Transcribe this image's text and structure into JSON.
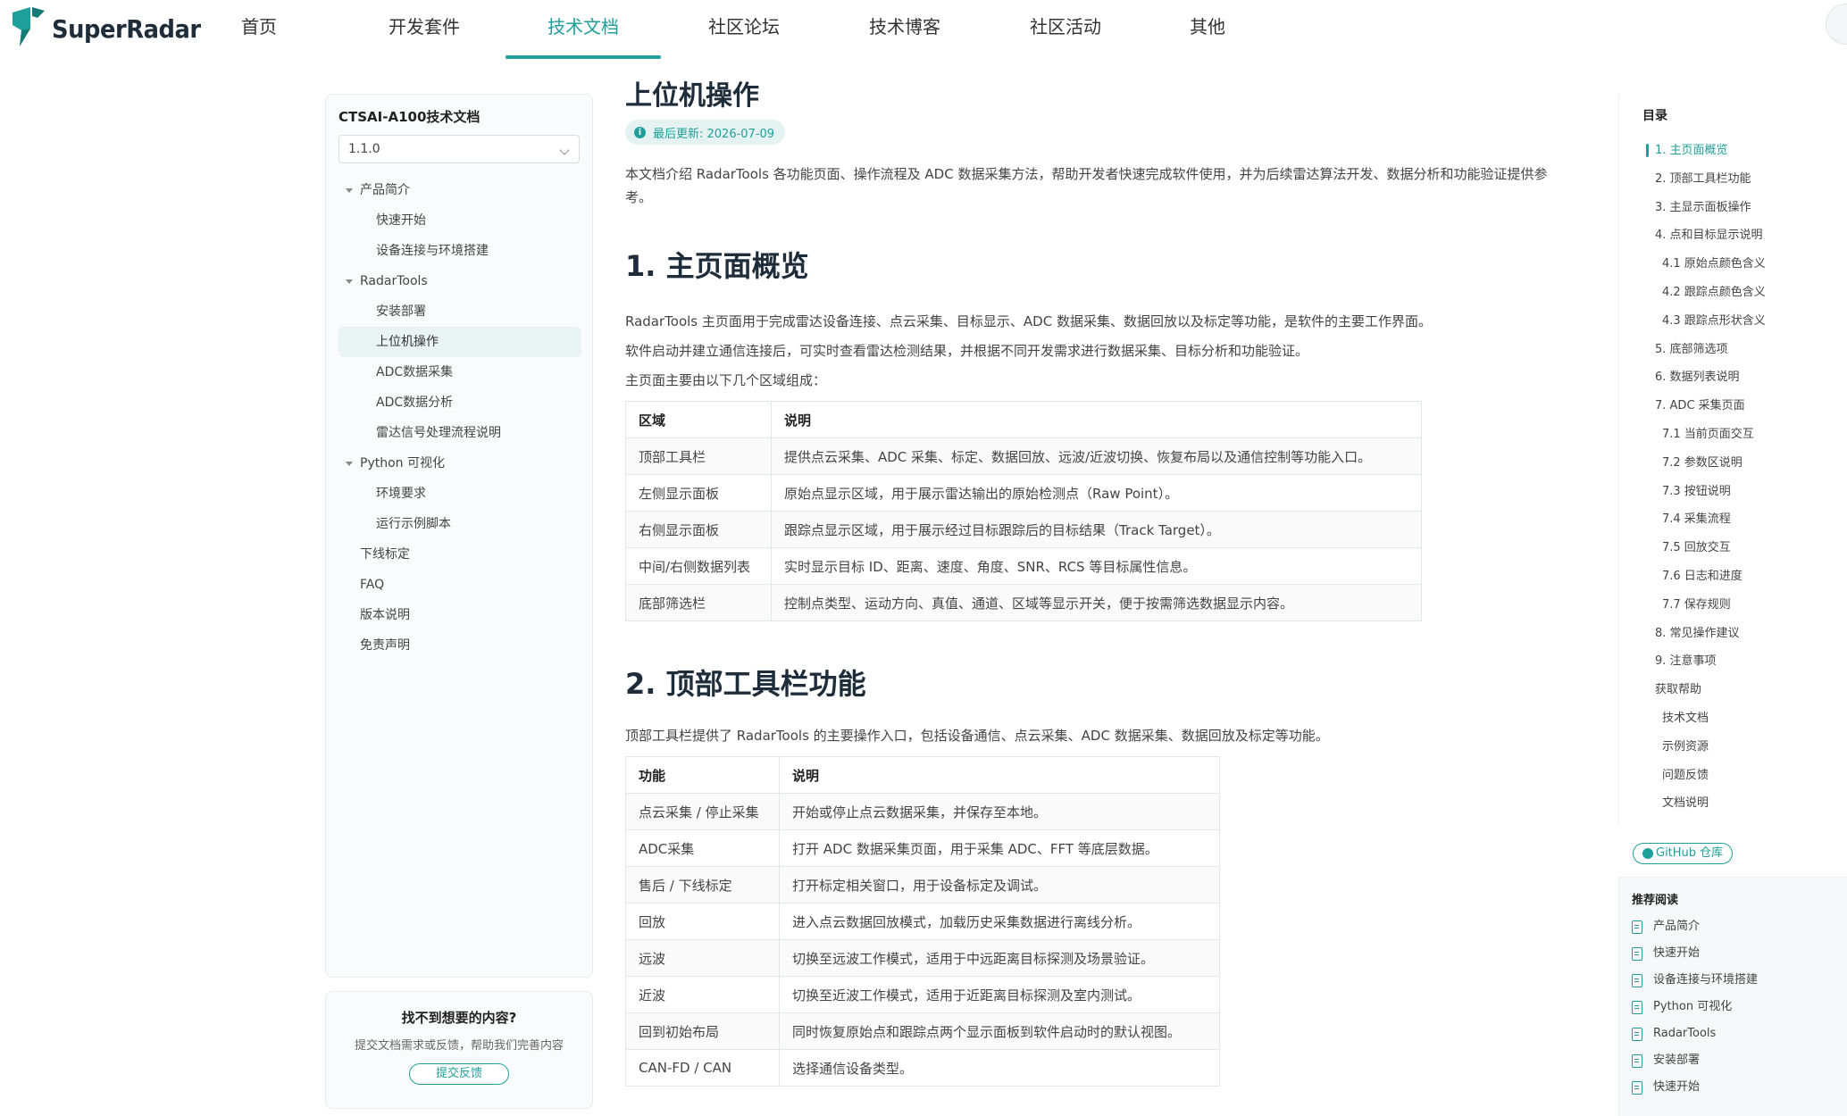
{
  "brand": {
    "name": "SuperRadar"
  },
  "nav": [
    {
      "label": "首页",
      "active": false
    },
    {
      "label": "开发套件",
      "active": false
    },
    {
      "label": "技术文档",
      "active": true
    },
    {
      "label": "社区论坛",
      "active": false
    },
    {
      "label": "技术博客",
      "active": false
    },
    {
      "label": "社区活动",
      "active": false
    },
    {
      "label": "其他",
      "active": false
    }
  ],
  "sidebar": {
    "title": "CTSAI-A100技术文档",
    "version": "1.1.0",
    "items": [
      {
        "label": "产品简介",
        "level": 1,
        "expanded": true
      },
      {
        "label": "快速开始",
        "level": 2
      },
      {
        "label": "设备连接与环境搭建",
        "level": 2
      },
      {
        "label": "RadarTools",
        "level": 1,
        "expanded": true
      },
      {
        "label": "安装部署",
        "level": 2
      },
      {
        "label": "上位机操作",
        "level": 2,
        "active": true
      },
      {
        "label": "ADC数据采集",
        "level": 2
      },
      {
        "label": "ADC数据分析",
        "level": 2
      },
      {
        "label": "雷达信号处理流程说明",
        "level": 2
      },
      {
        "label": "Python 可视化",
        "level": 1,
        "expanded": true
      },
      {
        "label": "环境要求",
        "level": 2
      },
      {
        "label": "运行示例脚本",
        "level": 2
      },
      {
        "label": "下线标定",
        "level": 1
      },
      {
        "label": "FAQ",
        "level": 1
      },
      {
        "label": "版本说明",
        "level": 1
      },
      {
        "label": "免责声明",
        "level": 1
      }
    ]
  },
  "feedback": {
    "title": "找不到想要的内容?",
    "desc": "提交文档需求或反馈，帮助我们完善内容",
    "button": "提交反馈"
  },
  "main": {
    "title": "上位机操作",
    "updated": "最后更新: 2026-07-09",
    "intro": "本文档介绍 RadarTools 各功能页面、操作流程及 ADC 数据采集方法，帮助开发者快速完成软件使用，并为后续雷达算法开发、数据分析和功能验证提供参考。",
    "s1": {
      "heading": "1. 主页面概览",
      "p1": "RadarTools 主页面用于完成雷达设备连接、点云采集、目标显示、ADC 数据采集、数据回放以及标定等功能，是软件的主要工作界面。",
      "p2": "软件启动并建立通信连接后，可实时查看雷达检测结果，并根据不同开发需求进行数据采集、目标分析和功能验证。",
      "p3": "主页面主要由以下几个区域组成：",
      "table": {
        "headers": [
          "区域",
          "说明"
        ],
        "rows": [
          [
            "顶部工具栏",
            "提供点云采集、ADC 采集、标定、数据回放、远波/近波切换、恢复布局以及通信控制等功能入口。"
          ],
          [
            "左侧显示面板",
            "原始点显示区域，用于展示雷达输出的原始检测点（Raw Point）。"
          ],
          [
            "右侧显示面板",
            "跟踪点显示区域，用于展示经过目标跟踪后的目标结果（Track Target）。"
          ],
          [
            "中间/右侧数据列表",
            "实时显示目标 ID、距离、速度、角度、SNR、RCS 等目标属性信息。"
          ],
          [
            "底部筛选栏",
            "控制点类型、运动方向、真值、通道、区域等显示开关，便于按需筛选数据显示内容。"
          ]
        ]
      }
    },
    "s2": {
      "heading": "2. 顶部工具栏功能",
      "p1": "顶部工具栏提供了 RadarTools 的主要操作入口，包括设备通信、点云采集、ADC 数据采集、数据回放及标定等功能。",
      "table": {
        "headers": [
          "功能",
          "说明"
        ],
        "rows": [
          [
            "点云采集 / 停止采集",
            "开始或停止点云数据采集，并保存至本地。"
          ],
          [
            "ADC采集",
            "打开 ADC 数据采集页面，用于采集 ADC、FFT 等底层数据。"
          ],
          [
            "售后 / 下线标定",
            "打开标定相关窗口，用于设备标定及调试。"
          ],
          [
            "回放",
            "进入点云数据回放模式，加载历史采集数据进行离线分析。"
          ],
          [
            "远波",
            "切换至远波工作模式，适用于中远距离目标探测及场景验证。"
          ],
          [
            "近波",
            "切换至近波工作模式，适用于近距离目标探测及室内测试。"
          ],
          [
            "回到初始布局",
            "同时恢复原始点和跟踪点两个显示面板到软件启动时的默认视图。"
          ],
          [
            "CAN-FD / CAN",
            "选择通信设备类型。"
          ]
        ]
      }
    }
  },
  "toc": {
    "title": "目录",
    "items": [
      {
        "label": "1. 主页面概览",
        "level": 1,
        "active": true
      },
      {
        "label": "2. 顶部工具栏功能",
        "level": 1
      },
      {
        "label": "3. 主显示面板操作",
        "level": 1
      },
      {
        "label": "4. 点和目标显示说明",
        "level": 1
      },
      {
        "label": "4.1 原始点颜色含义",
        "level": 2
      },
      {
        "label": "4.2 跟踪点颜色含义",
        "level": 2
      },
      {
        "label": "4.3 跟踪点形状含义",
        "level": 2
      },
      {
        "label": "5. 底部筛选项",
        "level": 1
      },
      {
        "label": "6. 数据列表说明",
        "level": 1
      },
      {
        "label": "7. ADC 采集页面",
        "level": 1
      },
      {
        "label": "7.1 当前页面交互",
        "level": 2
      },
      {
        "label": "7.2 参数区说明",
        "level": 2
      },
      {
        "label": "7.3 按钮说明",
        "level": 2
      },
      {
        "label": "7.4 采集流程",
        "level": 2
      },
      {
        "label": "7.5 回放交互",
        "level": 2
      },
      {
        "label": "7.6 日志和进度",
        "level": 2
      },
      {
        "label": "7.7 保存规则",
        "level": 2
      },
      {
        "label": "8. 常见操作建议",
        "level": 1
      },
      {
        "label": "9. 注意事项",
        "level": 1
      },
      {
        "label": "获取帮助",
        "level": 1
      },
      {
        "label": "技术文档",
        "level": 2
      },
      {
        "label": "示例资源",
        "level": 2
      },
      {
        "label": "问题反馈",
        "level": 2
      },
      {
        "label": "文档说明",
        "level": 2
      }
    ]
  },
  "github": {
    "label": "GitHub 仓库"
  },
  "recommended": {
    "title": "推荐阅读",
    "items": [
      "产品简介",
      "快速开始",
      "设备连接与环境搭建",
      "Python 可视化",
      "RadarTools",
      "安装部署",
      "快速开始"
    ]
  },
  "colors": {
    "accent": "#1f9f9a",
    "text": "#333333",
    "border": "#e3e6ea"
  }
}
